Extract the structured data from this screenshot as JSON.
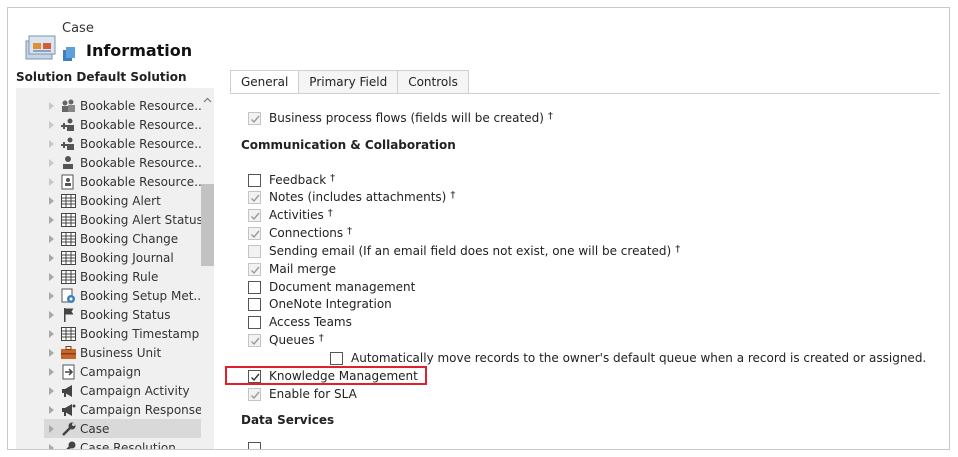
{
  "header": {
    "entity": "Case",
    "title": "Information"
  },
  "solution": {
    "label": "Solution Default Solution"
  },
  "tree": {
    "items": [
      {
        "label": "Bookable Resource...",
        "icon": "people-group-icon"
      },
      {
        "label": "Bookable Resource...",
        "icon": "person-plus-icon"
      },
      {
        "label": "Bookable Resource...",
        "icon": "person-plus-icon"
      },
      {
        "label": "Bookable Resource...",
        "icon": "person-icon"
      },
      {
        "label": "Bookable Resource...",
        "icon": "document-person-icon"
      },
      {
        "label": "Booking Alert",
        "icon": "grid-icon"
      },
      {
        "label": "Booking Alert Status",
        "icon": "grid-icon"
      },
      {
        "label": "Booking Change",
        "icon": "grid-icon"
      },
      {
        "label": "Booking Journal",
        "icon": "grid-icon"
      },
      {
        "label": "Booking Rule",
        "icon": "grid-icon"
      },
      {
        "label": "Booking Setup Met...",
        "icon": "settings-doc-icon"
      },
      {
        "label": "Booking Status",
        "icon": "flag-icon"
      },
      {
        "label": "Booking Timestamp",
        "icon": "grid-icon"
      },
      {
        "label": "Business Unit",
        "icon": "briefcase-icon"
      },
      {
        "label": "Campaign",
        "icon": "arrow-doc-icon"
      },
      {
        "label": "Campaign Activity",
        "icon": "megaphone-icon"
      },
      {
        "label": "Campaign Response",
        "icon": "megaphone-icon"
      },
      {
        "label": "Case",
        "icon": "wrench-icon"
      },
      {
        "label": "Case Resolution",
        "icon": "case-resolution-icon"
      }
    ],
    "selected": "Case"
  },
  "tabs": [
    {
      "label": "General",
      "active": true
    },
    {
      "label": "Primary Field",
      "active": false
    },
    {
      "label": "Controls",
      "active": false
    }
  ],
  "general": {
    "bpf": {
      "label": "Business process flows (fields will be created)",
      "dagger": "†",
      "checked": true,
      "disabled": true
    },
    "comm_section": "Communication & Collaboration",
    "options": [
      {
        "label": "Feedback",
        "dagger": "†",
        "checked": false,
        "disabled": false
      },
      {
        "label": "Notes (includes attachments)",
        "dagger": "†",
        "checked": true,
        "disabled": true
      },
      {
        "label": "Activities",
        "dagger": "†",
        "checked": true,
        "disabled": true
      },
      {
        "label": "Connections",
        "dagger": "†",
        "checked": true,
        "disabled": true
      },
      {
        "label": "Sending email (If an email field does not exist, one will be created)",
        "dagger": "†",
        "checked": false,
        "disabled": true
      },
      {
        "label": "Mail merge",
        "dagger": "",
        "checked": true,
        "disabled": true
      },
      {
        "label": "Document management",
        "dagger": "",
        "checked": false,
        "disabled": false
      },
      {
        "label": "OneNote Integration",
        "dagger": "",
        "checked": false,
        "disabled": false
      },
      {
        "label": "Access Teams",
        "dagger": "",
        "checked": false,
        "disabled": false
      },
      {
        "label": "Queues",
        "dagger": "†",
        "checked": true,
        "disabled": true
      }
    ],
    "queue_auto": {
      "label": "Automatically move records to the owner's default queue when a record is created or assigned.",
      "checked": false
    },
    "knowledge": {
      "label": "Knowledge Management",
      "checked": true,
      "disabled": false
    },
    "sla": {
      "label": "Enable for SLA",
      "checked": true,
      "disabled": true
    },
    "data_section": "Data Services"
  },
  "colors": {
    "highlight": "#e0202a",
    "tree_bg": "#f0f0f0",
    "selected_bg": "#d9d9d9"
  }
}
